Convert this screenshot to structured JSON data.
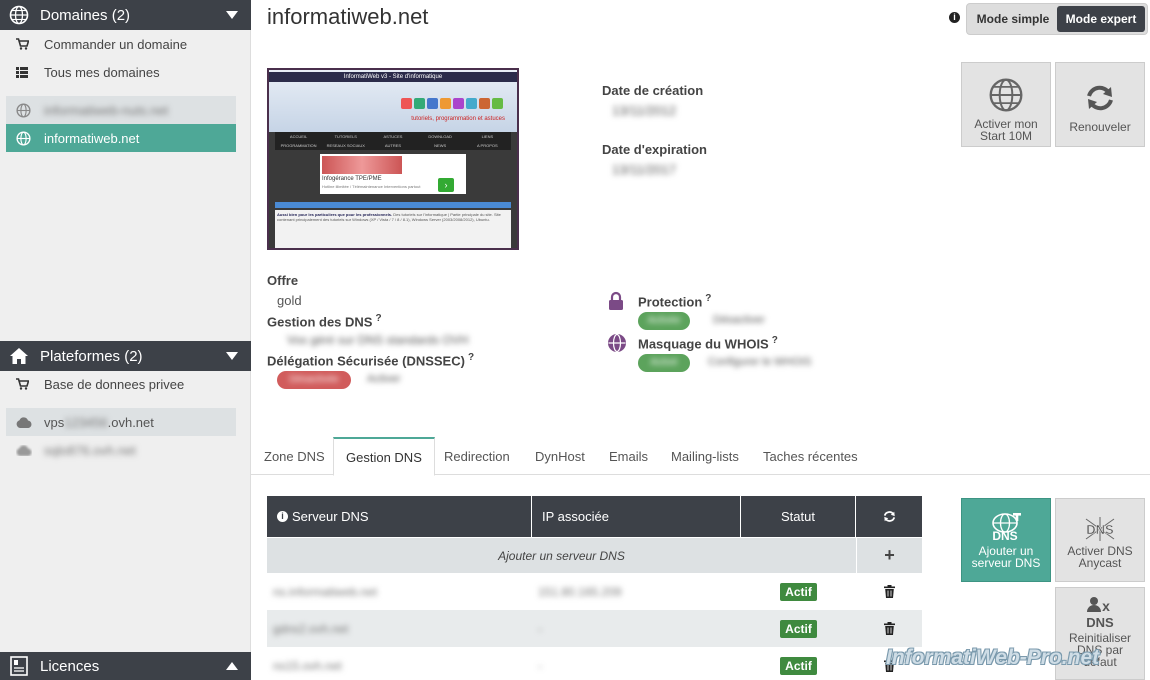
{
  "sidebar": {
    "domains": {
      "title": "Domaines (2)",
      "links": [
        {
          "label": "Commander un domaine",
          "icon": "cart-icon"
        },
        {
          "label": "Tous mes domaines",
          "icon": "list-icon"
        }
      ],
      "items": [
        {
          "label": "informatiweb-nuts.net",
          "icon": "globe-icon",
          "state": "muted",
          "blurred": true
        },
        {
          "label": "informatiweb.net",
          "icon": "globe-icon",
          "state": "active",
          "blurred": false
        }
      ]
    },
    "platforms": {
      "title": "Plateformes (2)",
      "links": [
        {
          "label": "Base de donnees privee",
          "icon": "cart-icon"
        }
      ],
      "items": [
        {
          "label_prefix": "vps",
          "label_hidden": "123456",
          "label_suffix": ".ovh.net",
          "icon": "cloud-icon"
        },
        {
          "label": "sqlo876.ovh.net",
          "icon": "cloud-icon",
          "blurred": true
        }
      ]
    },
    "licences": {
      "title": "Licences"
    }
  },
  "header": {
    "domain": "informatiweb.net",
    "modes": {
      "simple": "Mode simple",
      "expert": "Mode expert",
      "selected": "expert"
    }
  },
  "preview": {
    "site_title": "InformatiWeb v3 - Site d'informatique",
    "tagline": "tutoriels, programmation et astuces",
    "menu": [
      "ACCUEIL",
      "TUTORIELS",
      "ASTUCES",
      "DOWNLOAD",
      "LIENS",
      "PROGRAMMATION",
      "RESEAUX SOCIAUX",
      "AUTRES",
      "NEWS",
      "A PROPOS"
    ],
    "ad_title": "Infogérance TPE/PME",
    "ad_sub": "Hotline illimitée / Télémaintenance Interventions partout",
    "intro_title": "Aussi bien pour les particuliers que pour les professionnels.",
    "intro_text": "Des tutoriels sur l'informatique | Partie principale du site. Site contenant principalement des tutoriels sur Windows (XP / Vista / 7 / 8 / 8.1), Windows Server (2003/2008/2012), Ubuntu."
  },
  "details": {
    "creation_label": "Date de création",
    "creation_value": "13/11/2012",
    "expiration_label": "Date d'expiration",
    "expiration_value": "13/11/2017",
    "offer_label": "Offre",
    "offer_value": "gold",
    "dns_mgmt_label": "Gestion des DNS",
    "dns_mgmt_value": "Vos géré sur DNS standards OVH",
    "dnssec_label": "Délégation Sécurisée (DNSSEC)",
    "dnssec_status": "Désactivée",
    "dnssec_action": "Activer",
    "protection_label": "Protection",
    "protection_status": "Activée",
    "protection_action": "Désactiver",
    "whois_label": "Masquage du WHOIS",
    "whois_status": "Activé",
    "whois_action": "Configurer le WHOIS",
    "help_mark": "?"
  },
  "actions_top": [
    {
      "label": "Activer mon Start 10M",
      "icon": "globe-icon"
    },
    {
      "label": "Renouveler",
      "icon": "refresh-icon"
    }
  ],
  "tabs": [
    "Zone DNS",
    "Gestion DNS",
    "Redirection",
    "DynHost",
    "Emails",
    "Mailing-lists",
    "Taches récentes"
  ],
  "active_tab": "Gestion DNS",
  "table": {
    "headers": {
      "server": "Serveur DNS",
      "ip": "IP associée",
      "status": "Statut"
    },
    "add_label": "Ajouter un serveur DNS",
    "rows": [
      {
        "server": "ns.informatiweb.net",
        "ip": "151.80.165.209",
        "status": "Actif"
      },
      {
        "server": "gdns2.ovh.net",
        "ip": "-",
        "status": "Actif"
      },
      {
        "server": "ns15.ovh.net",
        "ip": "-",
        "status": "Actif"
      }
    ]
  },
  "actions_dns": [
    {
      "label": "Ajouter un serveur DNS",
      "icon": "add-dns-icon",
      "primary": true
    },
    {
      "label": "Activer DNS Anycast",
      "icon": "dns-anycast-icon",
      "primary": false
    },
    {
      "label": "Reinitialiser DNS par defaut",
      "icon": "dns-reset-icon",
      "primary": false
    }
  ],
  "watermark": "InformatiWeb-Pro.net",
  "colors": {
    "dark": "#3d4148",
    "accent": "#4ea897",
    "green": "#3f8a3f",
    "red": "#d15c5c"
  }
}
